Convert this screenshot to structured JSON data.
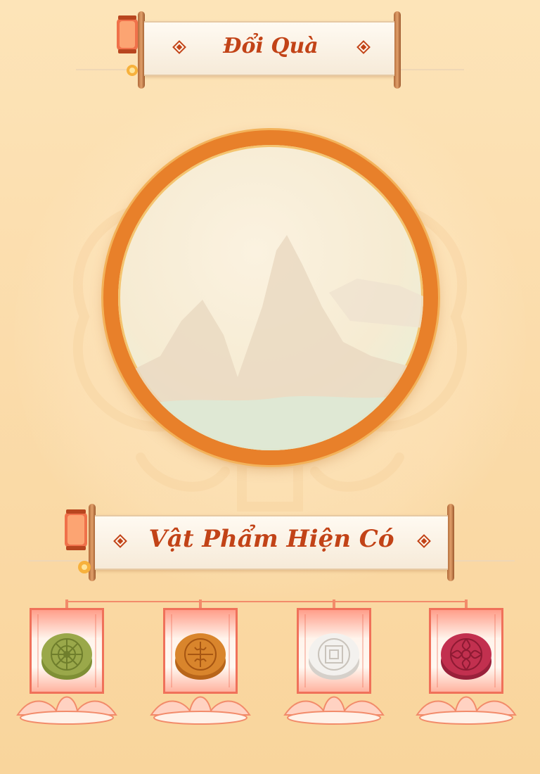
{
  "header": {
    "title": "Đổi Quà"
  },
  "items_section": {
    "title": "Vật Phẩm Hiện Có"
  },
  "items": [
    {
      "name": "green-mooncake",
      "color": "#9aa84a",
      "rim": "#7f8f35"
    },
    {
      "name": "orange-mooncake",
      "color": "#d9852c",
      "rim": "#b8651a"
    },
    {
      "name": "white-mooncake",
      "color": "#f3f1ee",
      "rim": "#d5d0ca"
    },
    {
      "name": "red-mooncake",
      "color": "#c2304f",
      "rim": "#99213b"
    }
  ],
  "colors": {
    "accent": "#c24317",
    "frame": "#e8802a",
    "lantern": "#f0714a"
  }
}
